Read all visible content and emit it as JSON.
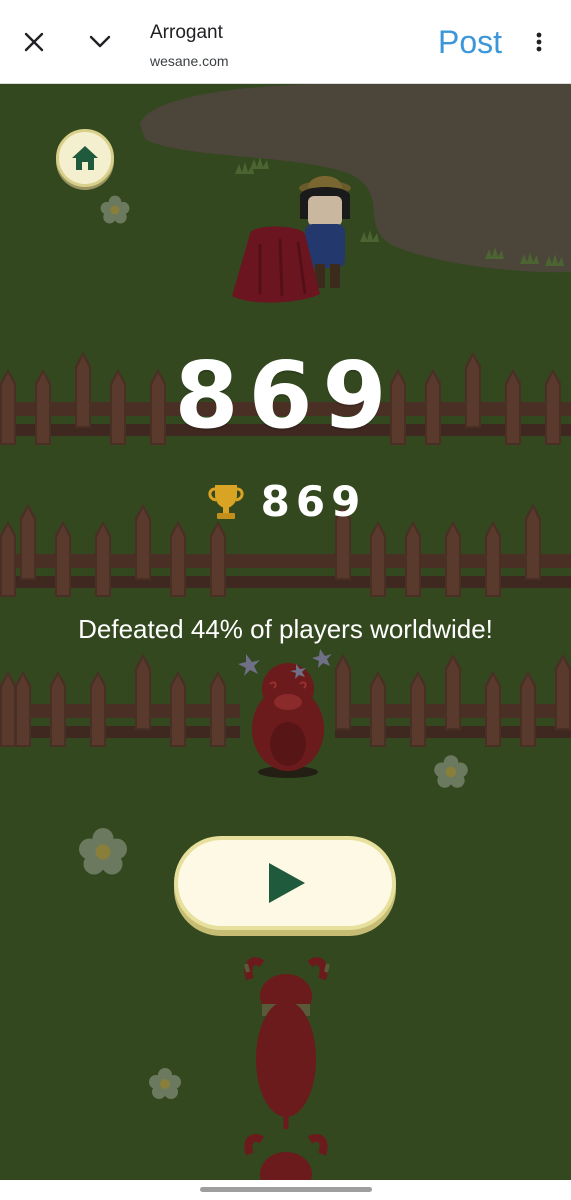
{
  "header": {
    "title": "Arrogant",
    "subtitle": "wesane.com",
    "post_label": "Post",
    "icons": {
      "close": "close-icon",
      "collapse": "chevron-down-icon",
      "menu": "more-vert-icon"
    },
    "post_color": "#3c97d8"
  },
  "game": {
    "score": "869",
    "best_score": "869",
    "defeated_message": "Defeated 44% of players worldwide!",
    "icons": {
      "home": "home-icon",
      "trophy": "trophy-icon",
      "play": "play-icon"
    },
    "colors": {
      "grass": "#33481f",
      "button_face": "#fdf9e4",
      "play_triangle": "#1f5a3c"
    }
  }
}
